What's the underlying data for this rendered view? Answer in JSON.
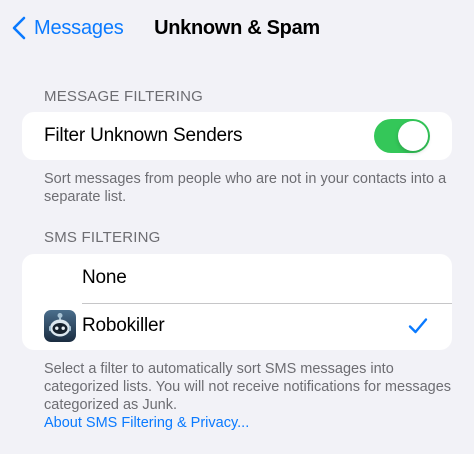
{
  "nav": {
    "back_label": "Messages",
    "title": "Unknown & Spam"
  },
  "message_filtering": {
    "header": "MESSAGE FILTERING",
    "filter_unknown_label": "Filter Unknown Senders",
    "filter_unknown_on": true,
    "footer": "Sort messages from people who are not in your contacts into a separate list."
  },
  "sms_filtering": {
    "header": "SMS FILTERING",
    "options": [
      {
        "label": "None",
        "selected": false
      },
      {
        "label": "Robokiller",
        "selected": true
      }
    ],
    "footer": "Select a filter to automatically sort SMS messages into categorized lists. You will not receive notifications for messages categorized as Junk.",
    "link": "About SMS Filtering & Privacy..."
  },
  "colors": {
    "accent": "#0a7aff",
    "toggle_on": "#34c759",
    "background": "#f2f2f7"
  },
  "icons": {
    "back": "chevron-left-icon",
    "check": "checkmark-icon",
    "app": "robokiller-app-icon"
  }
}
